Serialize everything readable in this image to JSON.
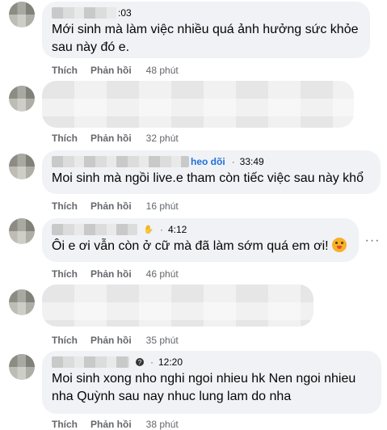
{
  "comments": [
    {
      "timestamp": ":03",
      "text": "Mới sinh mà làm việc nhiều quá ảnh hưởng sức khỏe sau này đó e.",
      "like": "Thích",
      "reply": "Phản hồi",
      "time": "48 phút"
    },
    {
      "like": "Thích",
      "reply": "Phản hồi",
      "time": "32 phút"
    },
    {
      "follow": "heo dõi",
      "timestamp": "33:49",
      "text": "Moi sinh mà ngồi live.e tham còn tiếc việc sau này khổ",
      "like": "Thích",
      "reply": "Phản hồi",
      "time": "16 phút"
    },
    {
      "timestamp": "4:12",
      "text": "Ôi e ơi vẫn còn ở cữ mà đã làm sớm quá em ơi!",
      "like": "Thích",
      "reply": "Phản hồi",
      "time": "46 phút",
      "more_icon": "ellipsis-icon"
    },
    {
      "like": "Thích",
      "reply": "Phản hồi",
      "time": "35 phút"
    },
    {
      "timestamp": "12:20",
      "text_line1": "Moi sinh xong nho nghi ngoi nhieu hk Nen ngoi nhieu",
      "text_line2": "nha Quỳnh sau nay nhuc lung lam do nha",
      "like": "Thích",
      "reply": "Phản hồi",
      "time": "38 phút"
    }
  ],
  "colors": {
    "bubble": "#f0f2f5",
    "action_text": "#65676b",
    "link": "#216fdb"
  }
}
